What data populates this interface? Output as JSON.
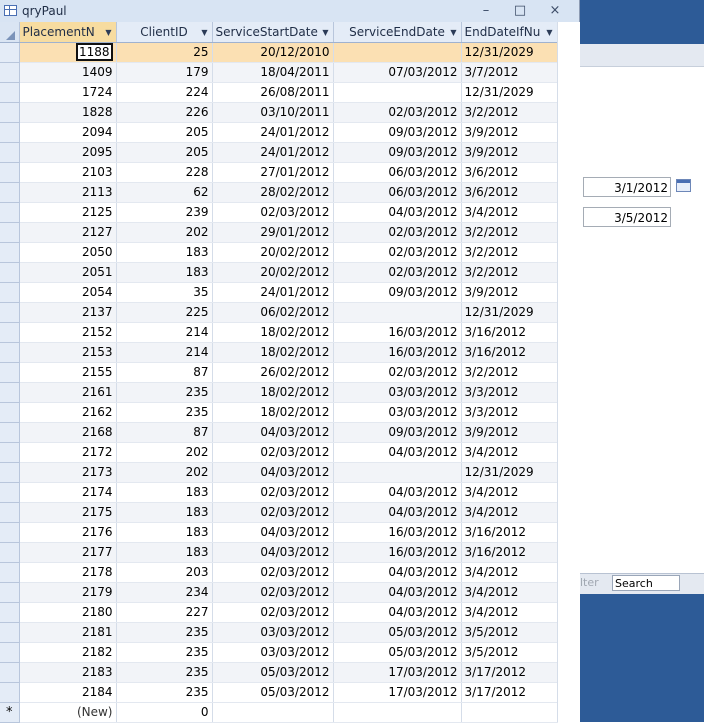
{
  "window": {
    "title": "qryPaul",
    "minimize_symbol": "–",
    "maximize_symbol": "□",
    "close_symbol": "×"
  },
  "background_form": {
    "date_field_1": "3/1/2012",
    "date_field_2": "3/5/2012",
    "filter_label": "lter",
    "search_label": "Search"
  },
  "columns": [
    "PlacementN",
    "ClientID",
    "ServiceStartDate",
    "ServiceEndDate",
    "EndDateIfNu"
  ],
  "rows": [
    [
      "1188",
      "25",
      "20/12/2010",
      "",
      "12/31/2029"
    ],
    [
      "1409",
      "179",
      "18/04/2011",
      "07/03/2012",
      "3/7/2012"
    ],
    [
      "1724",
      "224",
      "26/08/2011",
      "",
      "12/31/2029"
    ],
    [
      "1828",
      "226",
      "03/10/2011",
      "02/03/2012",
      "3/2/2012"
    ],
    [
      "2094",
      "205",
      "24/01/2012",
      "09/03/2012",
      "3/9/2012"
    ],
    [
      "2095",
      "205",
      "24/01/2012",
      "09/03/2012",
      "3/9/2012"
    ],
    [
      "2103",
      "228",
      "27/01/2012",
      "06/03/2012",
      "3/6/2012"
    ],
    [
      "2113",
      "62",
      "28/02/2012",
      "06/03/2012",
      "3/6/2012"
    ],
    [
      "2125",
      "239",
      "02/03/2012",
      "04/03/2012",
      "3/4/2012"
    ],
    [
      "2127",
      "202",
      "29/01/2012",
      "02/03/2012",
      "3/2/2012"
    ],
    [
      "2050",
      "183",
      "20/02/2012",
      "02/03/2012",
      "3/2/2012"
    ],
    [
      "2051",
      "183",
      "20/02/2012",
      "02/03/2012",
      "3/2/2012"
    ],
    [
      "2054",
      "35",
      "24/01/2012",
      "09/03/2012",
      "3/9/2012"
    ],
    [
      "2137",
      "225",
      "06/02/2012",
      "",
      "12/31/2029"
    ],
    [
      "2152",
      "214",
      "18/02/2012",
      "16/03/2012",
      "3/16/2012"
    ],
    [
      "2153",
      "214",
      "18/02/2012",
      "16/03/2012",
      "3/16/2012"
    ],
    [
      "2155",
      "87",
      "26/02/2012",
      "02/03/2012",
      "3/2/2012"
    ],
    [
      "2161",
      "235",
      "18/02/2012",
      "03/03/2012",
      "3/3/2012"
    ],
    [
      "2162",
      "235",
      "18/02/2012",
      "03/03/2012",
      "3/3/2012"
    ],
    [
      "2168",
      "87",
      "04/03/2012",
      "09/03/2012",
      "3/9/2012"
    ],
    [
      "2172",
      "202",
      "02/03/2012",
      "04/03/2012",
      "3/4/2012"
    ],
    [
      "2173",
      "202",
      "04/03/2012",
      "",
      "12/31/2029"
    ],
    [
      "2174",
      "183",
      "02/03/2012",
      "04/03/2012",
      "3/4/2012"
    ],
    [
      "2175",
      "183",
      "02/03/2012",
      "04/03/2012",
      "3/4/2012"
    ],
    [
      "2176",
      "183",
      "04/03/2012",
      "16/03/2012",
      "3/16/2012"
    ],
    [
      "2177",
      "183",
      "04/03/2012",
      "16/03/2012",
      "3/16/2012"
    ],
    [
      "2178",
      "203",
      "02/03/2012",
      "04/03/2012",
      "3/4/2012"
    ],
    [
      "2179",
      "234",
      "02/03/2012",
      "04/03/2012",
      "3/4/2012"
    ],
    [
      "2180",
      "227",
      "02/03/2012",
      "04/03/2012",
      "3/4/2012"
    ],
    [
      "2181",
      "235",
      "03/03/2012",
      "05/03/2012",
      "3/5/2012"
    ],
    [
      "2182",
      "235",
      "03/03/2012",
      "05/03/2012",
      "3/5/2012"
    ],
    [
      "2183",
      "235",
      "05/03/2012",
      "17/03/2012",
      "3/17/2012"
    ],
    [
      "2184",
      "235",
      "05/03/2012",
      "17/03/2012",
      "3/17/2012"
    ]
  ],
  "new_row": {
    "marker": "*",
    "label": "(New)",
    "default_client": "0"
  }
}
